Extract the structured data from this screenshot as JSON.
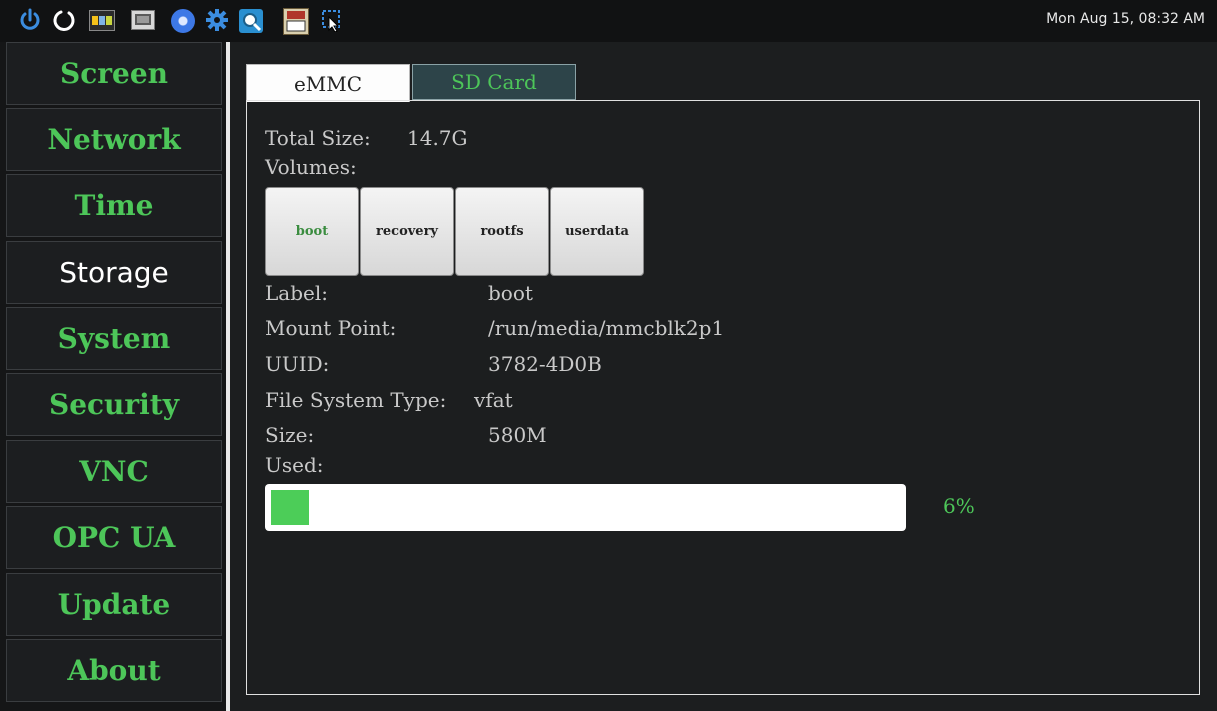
{
  "taskbar": {
    "clock": "Mon Aug 15, 08:32 AM",
    "icons": [
      "power-icon",
      "restart-icon",
      "nxp-icon",
      "monitor-icon",
      "chromium-icon",
      "settings-gear-icon",
      "magnifier-app-icon",
      "tightvnc-icon",
      "screen-select-icon"
    ]
  },
  "nav": {
    "items": [
      {
        "label": "Screen"
      },
      {
        "label": "Network"
      },
      {
        "label": "Time"
      },
      {
        "label": "Storage"
      },
      {
        "label": "System"
      },
      {
        "label": "Security"
      },
      {
        "label": "VNC"
      },
      {
        "label": "OPC UA"
      },
      {
        "label": "Update"
      },
      {
        "label": "About"
      }
    ],
    "active": "Storage"
  },
  "tabs": {
    "emmc": "eMMC",
    "sd": "SD Card",
    "selected": "eMMC"
  },
  "storage": {
    "total_size_label": "Total Size:",
    "total_size_value": "14.7G",
    "volumes_label": "Volumes:",
    "volumes": [
      "boot",
      "recovery",
      "rootfs",
      "userdata"
    ],
    "selected_volume": "boot",
    "details": {
      "label_label": "Label:",
      "label_value": "boot",
      "mount_label": "Mount Point:",
      "mount_value": "/run/media/mmcblk2p1",
      "uuid_label": "UUID:",
      "uuid_value": "3782-4D0B",
      "fs_label": "File System Type:",
      "fs_value": "vfat",
      "size_label": "Size:",
      "size_value": "580M",
      "used_label": "Used:",
      "used_percent_text": "6%",
      "used_fraction": 0.06
    }
  },
  "colors": {
    "accent_green": "#4dc659",
    "background": "#1c1e1f",
    "tab_inactive": "#2d4449"
  }
}
